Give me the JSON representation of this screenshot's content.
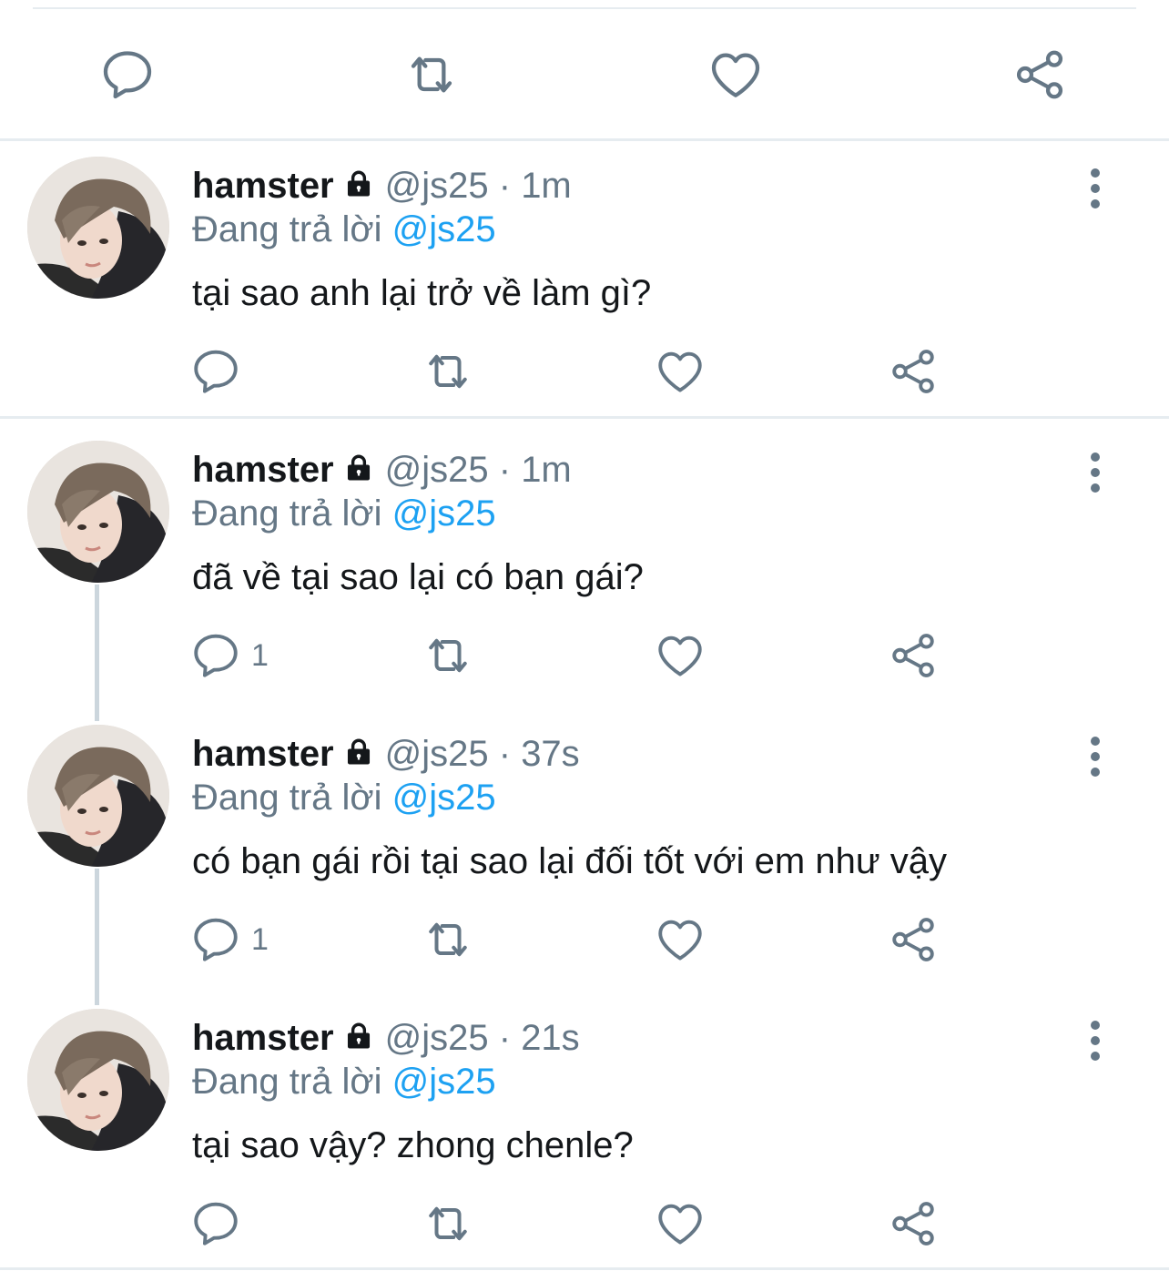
{
  "colors": {
    "text": "#14171a",
    "secondary": "#657786",
    "link": "#1da1f2",
    "divider": "#e6ecf0",
    "thread": "#ccd6dd"
  },
  "icons": {
    "reply": "reply-icon",
    "retweet": "retweet-icon",
    "like": "heart-icon",
    "share": "share-icon",
    "lock": "lock-icon",
    "more": "more-icon"
  },
  "tweets": [
    {
      "name": "hamster",
      "handle": "@js25",
      "dot": "·",
      "time": "1m",
      "reply_prefix": "Đang trả lời",
      "reply_to": "@js25",
      "text": "tại sao anh lại trở về làm gì?",
      "reply_count": ""
    },
    {
      "name": "hamster",
      "handle": "@js25",
      "dot": "·",
      "time": "1m",
      "reply_prefix": "Đang trả lời",
      "reply_to": "@js25",
      "text": "đã về tại sao lại có bạn gái?",
      "reply_count": "1"
    },
    {
      "name": "hamster",
      "handle": "@js25",
      "dot": "·",
      "time": "37s",
      "reply_prefix": "Đang trả lời",
      "reply_to": "@js25",
      "text": "có bạn gái rồi tại sao lại đối tốt với em như vậy",
      "reply_count": "1"
    },
    {
      "name": "hamster",
      "handle": "@js25",
      "dot": "·",
      "time": "21s",
      "reply_prefix": "Đang trả lời",
      "reply_to": "@js25",
      "text": "tại sao vậy? zhong chenle?",
      "reply_count": ""
    }
  ]
}
